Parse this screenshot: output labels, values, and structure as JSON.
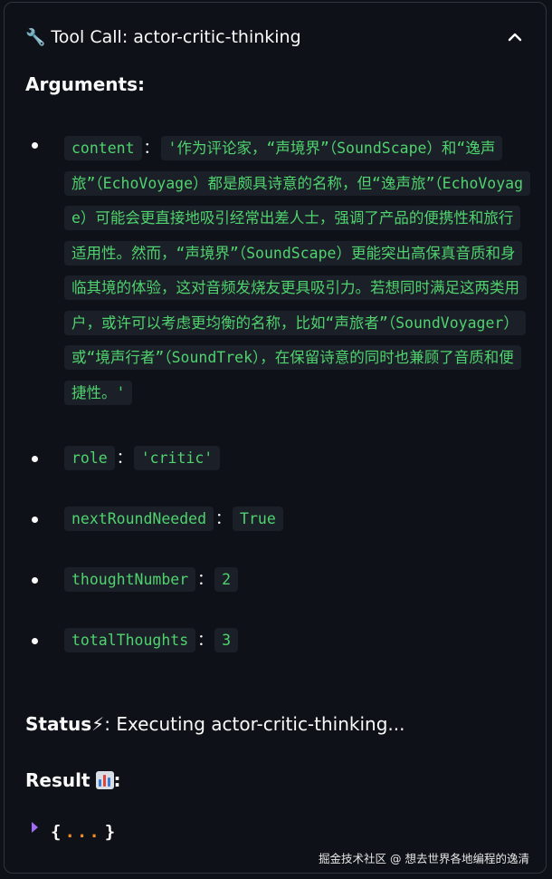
{
  "header": {
    "icon": "wrench-icon",
    "title": "Tool Call: actor-critic-thinking"
  },
  "arguments_title": "Arguments:",
  "arguments": {
    "content": {
      "key": "content",
      "value": "'作为评论家，“声境界”（SoundScape）和“逸声旅”（EchoVoyage）都是颇具诗意的名称，但“逸声旅”（EchoVoyage）可能会更直接地吸引经常出差人士，强调了产品的便携性和旅行适用性。然而，“声境界”（SoundScape）更能突出高保真音质和身临其境的体验，这对音频发烧友更具吸引力。若想同时满足这两类用户，或许可以考虑更均衡的名称，比如“声旅者”（SoundVoyager）或“境声行者”（SoundTrek），在保留诗意的同时也兼顾了音质和便捷性。'"
    },
    "role": {
      "key": "role",
      "value": "'critic'"
    },
    "nextRoundNeeded": {
      "key": "nextRoundNeeded",
      "value": "True"
    },
    "thoughtNumber": {
      "key": "thoughtNumber",
      "value": "2"
    },
    "totalThoughts": {
      "key": "totalThoughts",
      "value": "3"
    }
  },
  "colon": "：",
  "status": {
    "label": "Status",
    "icon": "lightning-icon",
    "text": ": Executing actor-critic-thinking..."
  },
  "result": {
    "label": "Result",
    "icon": "bar-chart-icon",
    "suffix": ":"
  },
  "json_preview": {
    "open": "{",
    "dots": "...",
    "close": "}"
  },
  "watermark": "掘金技术社区 @ 想去世界各地编程的逸清",
  "colors": {
    "code_green": "#4fd36e",
    "code_bg": "#1b1f27",
    "toggle_purple": "#a06cf5",
    "dots_orange": "#f08a24"
  }
}
